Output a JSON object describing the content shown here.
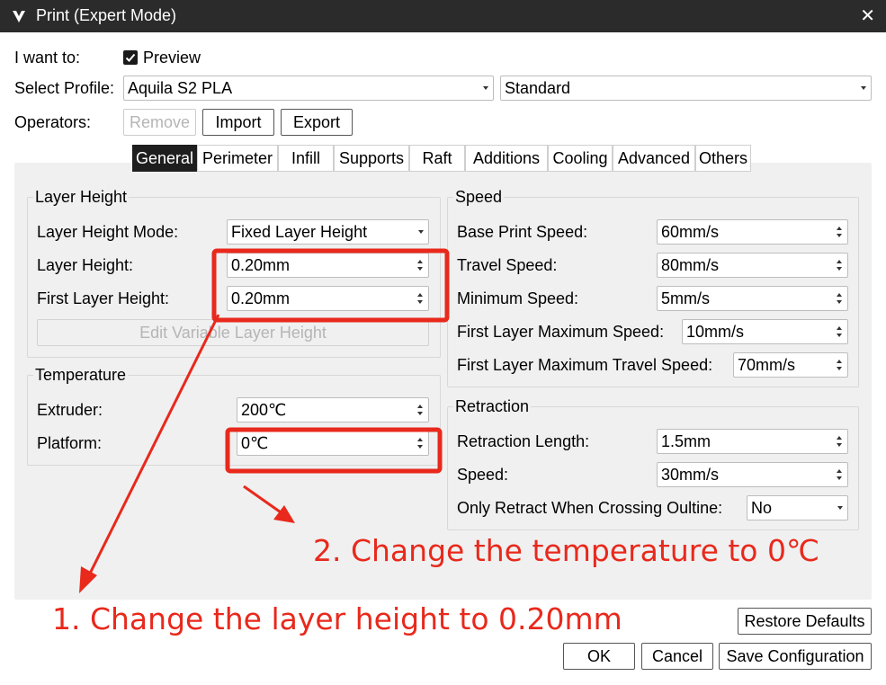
{
  "window": {
    "title": "Print (Expert Mode)",
    "close_glyph": "✕"
  },
  "want_to": {
    "label": "I want to:",
    "preview_label": "Preview",
    "preview_checked": true
  },
  "profile": {
    "label": "Select Profile:",
    "printer": "Aquila S2 PLA",
    "quality": "Standard"
  },
  "operators": {
    "label": "Operators:",
    "remove": "Remove",
    "import": "Import",
    "export": "Export"
  },
  "tabs": [
    "General",
    "Perimeter",
    "Infill",
    "Supports",
    "Raft",
    "Additions",
    "Cooling",
    "Advanced",
    "Others"
  ],
  "active_tab": "General",
  "layer_height_group": {
    "title": "Layer Height",
    "mode_label": "Layer Height Mode:",
    "mode_value": "Fixed Layer Height",
    "height_label": "Layer Height:",
    "height_value": "0.20mm",
    "first_label": "First Layer Height:",
    "first_value": "0.20mm",
    "edit_button": "Edit Variable Layer Height"
  },
  "temperature_group": {
    "title": "Temperature",
    "extruder_label": "Extruder:",
    "extruder_value": "200℃",
    "platform_label": "Platform:",
    "platform_value": "0℃"
  },
  "speed_group": {
    "title": "Speed",
    "base_label": "Base Print Speed:",
    "base_value": "60mm/s",
    "travel_label": "Travel Speed:",
    "travel_value": "80mm/s",
    "min_label": "Minimum Speed:",
    "min_value": "5mm/s",
    "first_max_label": "First Layer Maximum Speed:",
    "first_max_value": "10mm/s",
    "first_travel_label": "First Layer Maximum Travel Speed:",
    "first_travel_value": "70mm/s"
  },
  "retraction_group": {
    "title": "Retraction",
    "length_label": "Retraction Length:",
    "length_value": "1.5mm",
    "speed_label": "Speed:",
    "speed_value": "30mm/s",
    "only_label": "Only Retract When Crossing Oultine:",
    "only_value": "No"
  },
  "footer": {
    "restore": "Restore Defaults",
    "ok": "OK",
    "cancel": "Cancel",
    "save": "Save Configuration"
  },
  "annotations": {
    "step1": "1. Change the layer height to 0.20mm",
    "step2": "2. Change the temperature to 0℃",
    "color": "#e8291c"
  },
  "icons": {
    "logo": "app-logo-icon",
    "close": "close-icon",
    "check": "check-icon",
    "dropdown": "chevron-down-icon",
    "spin": "spin-arrows-icon"
  }
}
